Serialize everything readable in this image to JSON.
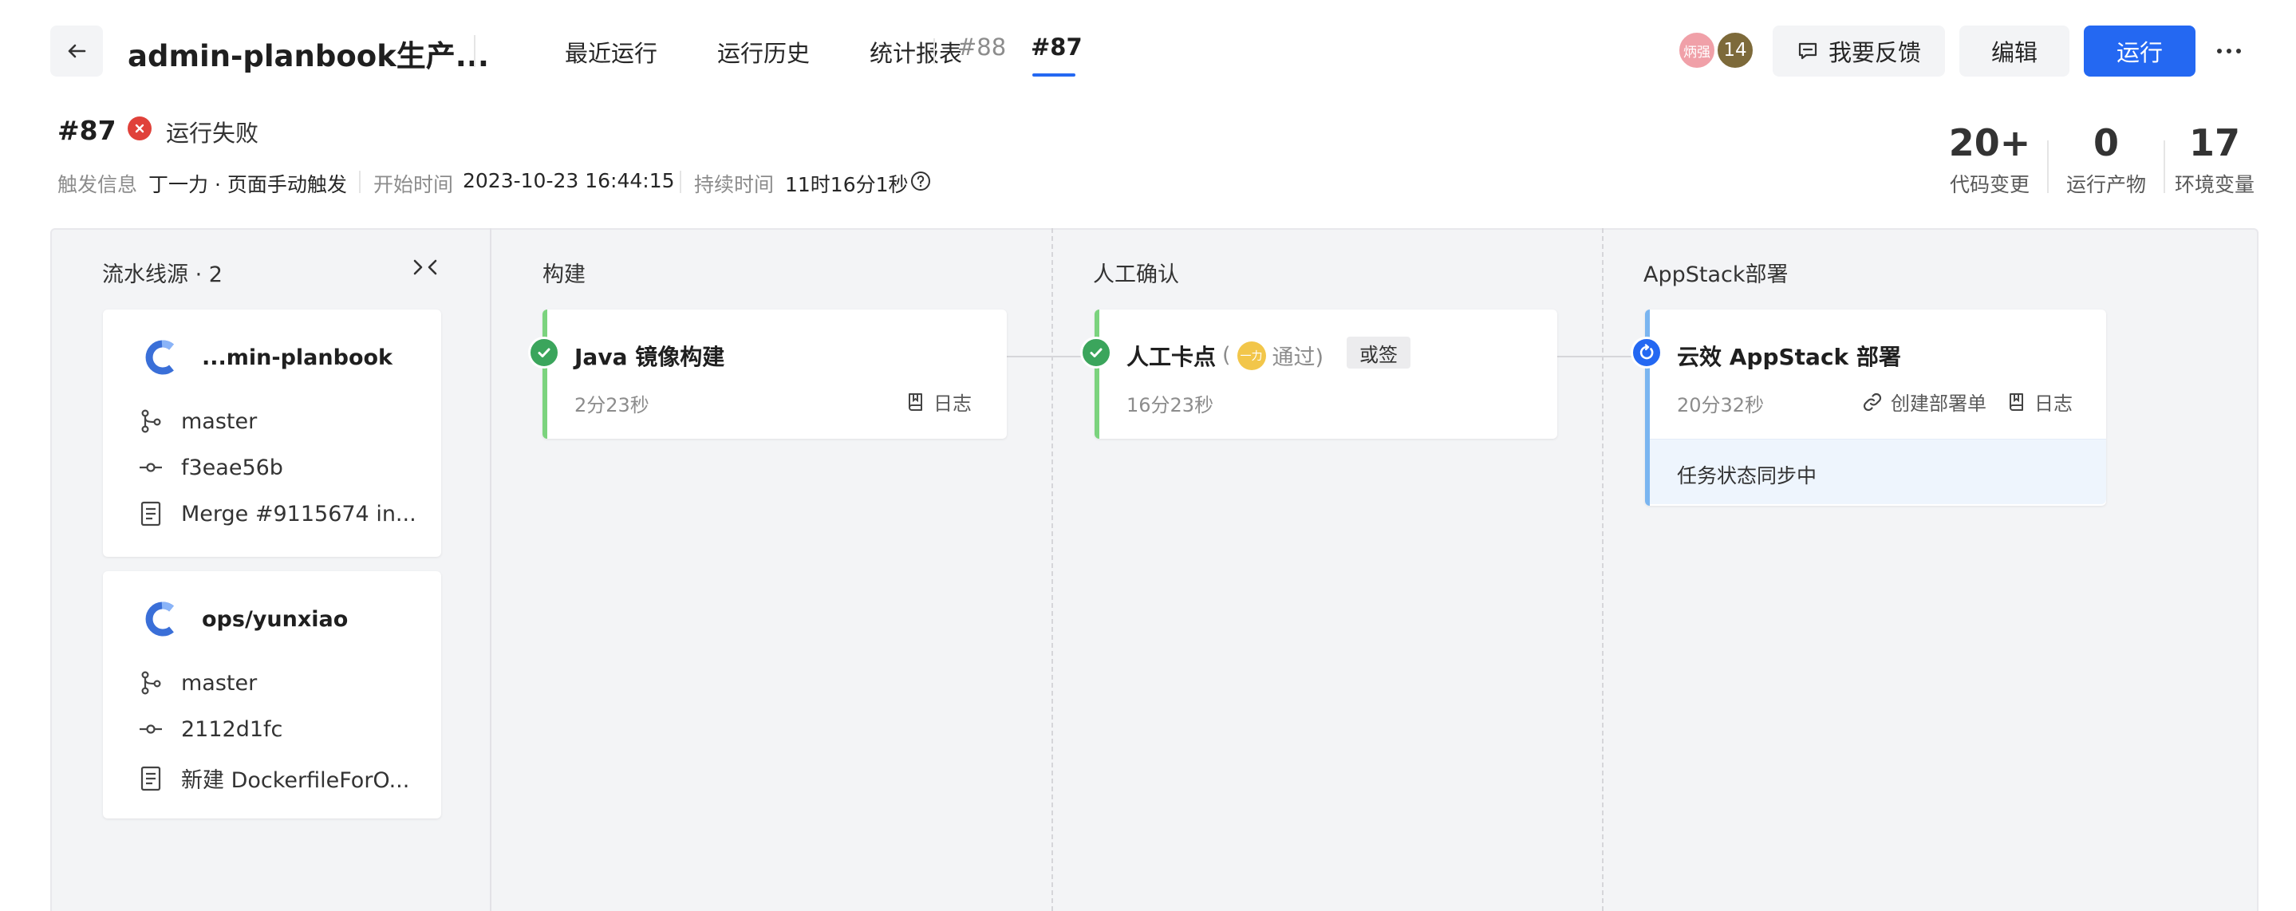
{
  "header": {
    "title": "admin-planbook生产...",
    "nav": [
      "最近运行",
      "运行历史",
      "统计报表"
    ],
    "run_tabs": [
      "#88",
      "#87"
    ],
    "active_tab": "#87",
    "avatars": [
      "炳强",
      "14"
    ],
    "feedback_label": "我要反馈",
    "edit_label": "编辑",
    "run_label": "运行",
    "accent_color": "#2468f2"
  },
  "run": {
    "id": "#87",
    "status": "运行失败",
    "status_color": "#e0413a",
    "trigger_label": "触发信息",
    "trigger_value": "丁一力 · 页面手动触发",
    "start_label": "开始时间",
    "start_value": "2023-10-23 16:44:15",
    "duration_label": "持续时间",
    "duration_value": "11时16分1秒"
  },
  "stats": [
    {
      "value": "20+",
      "label": "代码变更"
    },
    {
      "value": "0",
      "label": "运行产物"
    },
    {
      "value": "17",
      "label": "环境变量"
    }
  ],
  "sources": {
    "title": "流水线源 · 2",
    "items": [
      {
        "name": "...min-planbook",
        "branch": "master",
        "commit": "f3eae56b",
        "message": "Merge #9115674 in..."
      },
      {
        "name": "ops/yunxiao",
        "branch": "master",
        "commit": "2112d1fc",
        "message": "新建 DockerfileForO..."
      }
    ]
  },
  "stages": [
    {
      "title": "构建",
      "job": {
        "name": "Java 镜像构建",
        "duration": "2分23秒",
        "log_label": "日志",
        "status": "success"
      }
    },
    {
      "title": "人工确认",
      "job": {
        "name": "人工卡点",
        "approver_avatar": "一力",
        "approve_open": "(",
        "approve_state": "通过)",
        "tag": "或签",
        "duration": "16分23秒",
        "status": "success"
      }
    },
    {
      "title": "AppStack部署",
      "job": {
        "name": "云效 AppStack 部署",
        "duration": "20分32秒",
        "create_label": "创建部署单",
        "log_label": "日志",
        "sync_text": "任务状态同步中",
        "status": "running"
      }
    }
  ]
}
